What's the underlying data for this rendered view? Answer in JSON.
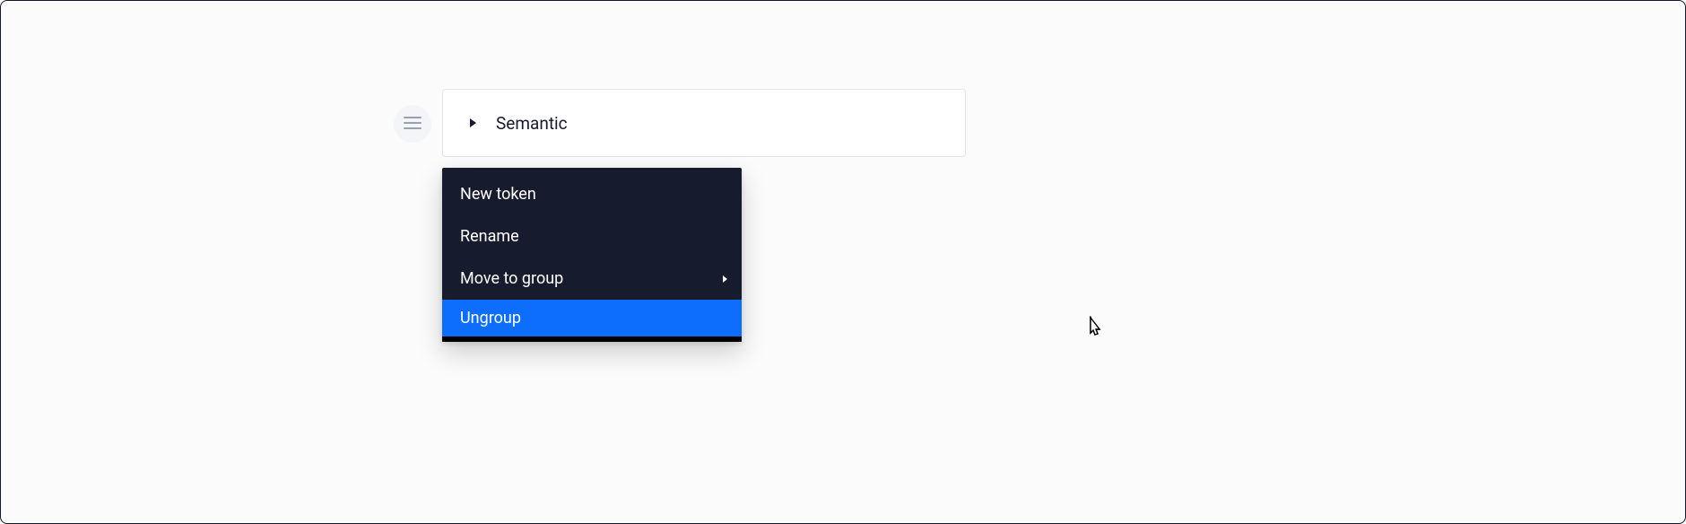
{
  "group": {
    "label": "Semantic"
  },
  "contextMenu": {
    "items": [
      {
        "label": "New token",
        "hasSubmenu": false,
        "highlighted": false
      },
      {
        "label": "Rename",
        "hasSubmenu": false,
        "highlighted": false
      },
      {
        "label": "Move to group",
        "hasSubmenu": true,
        "highlighted": false
      },
      {
        "label": "Ungroup",
        "hasSubmenu": false,
        "highlighted": true
      }
    ]
  }
}
